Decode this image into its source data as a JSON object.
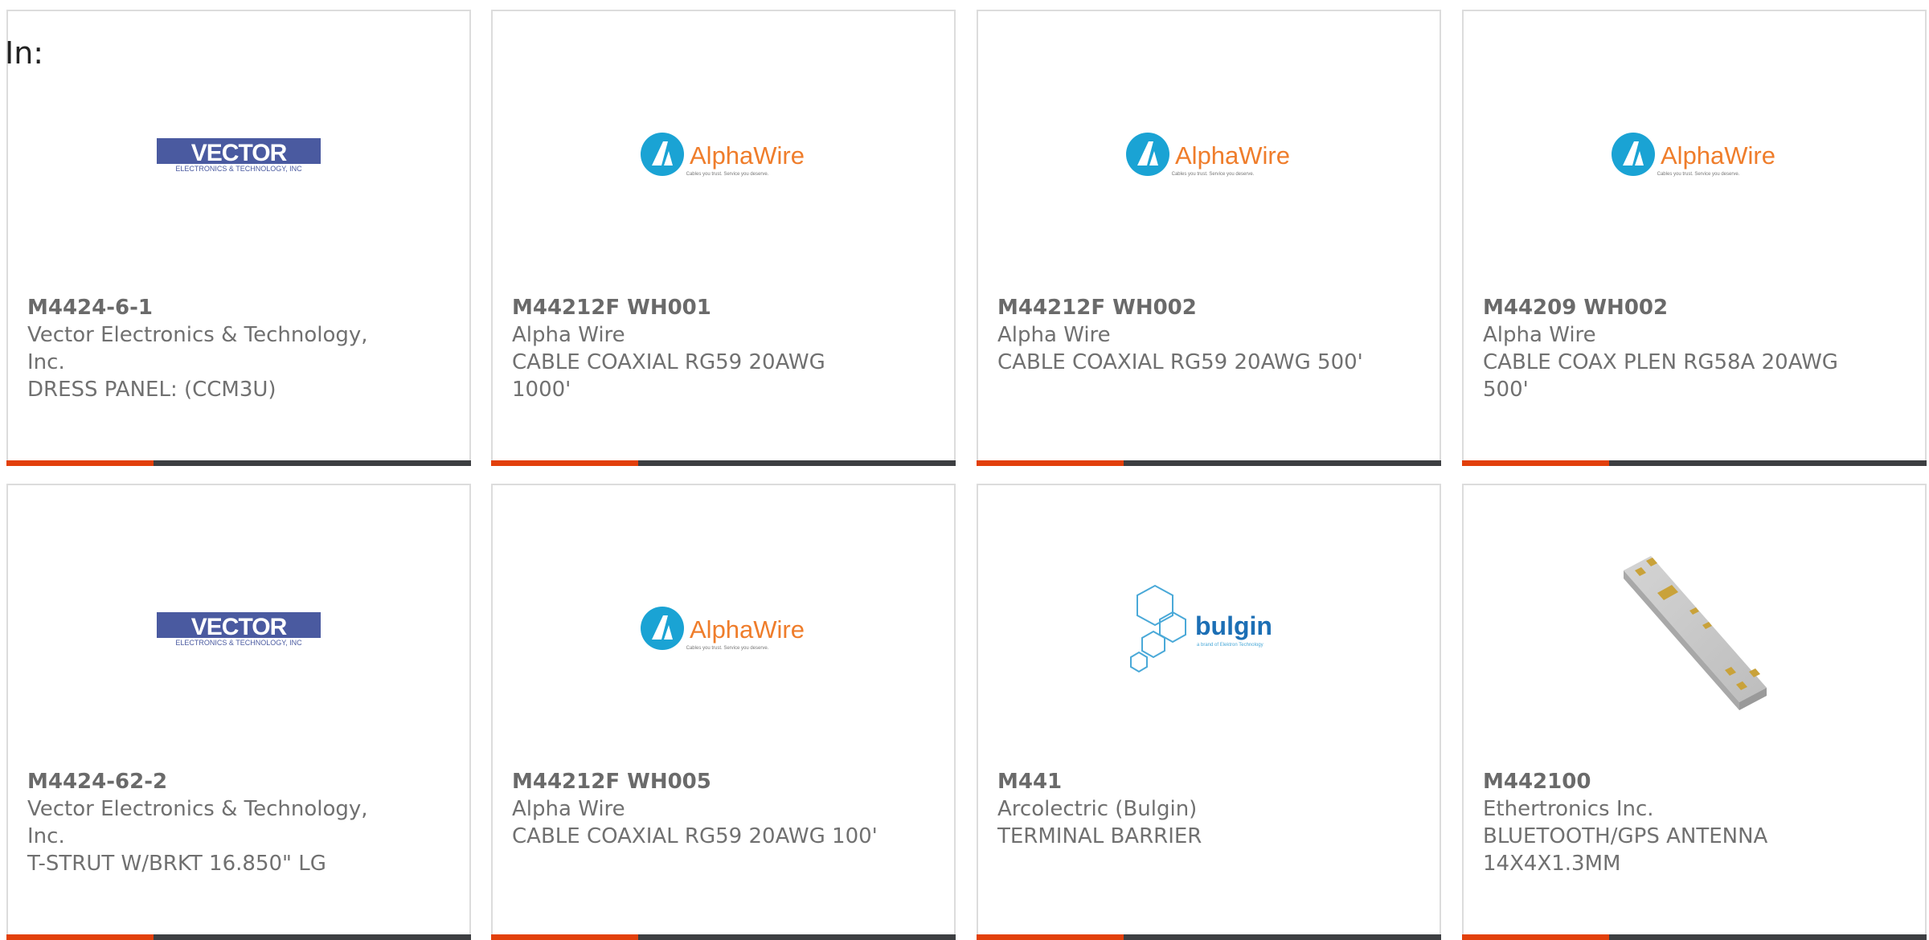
{
  "header": {
    "label": "In:"
  },
  "colors": {
    "accent": "#e2400b",
    "bar": "#3d3f42",
    "border": "#dcdcdc",
    "text": "#707070"
  },
  "products": [
    {
      "part": "M4424-6-1",
      "manufacturer": "Vector Electronics & Technology, Inc.",
      "description": "DRESS PANEL: (CCM3U)",
      "logo": "vector-logo"
    },
    {
      "part": "M44212F WH001",
      "manufacturer": "Alpha Wire",
      "description": "CABLE COAXIAL RG59 20AWG 1000'",
      "logo": "alphawire-logo"
    },
    {
      "part": "M44212F WH002",
      "manufacturer": "Alpha Wire",
      "description": "CABLE COAXIAL RG59 20AWG 500'",
      "logo": "alphawire-logo"
    },
    {
      "part": "M44209 WH002",
      "manufacturer": "Alpha Wire",
      "description": "CABLE COAX PLEN RG58A 20AWG 500'",
      "logo": "alphawire-logo"
    },
    {
      "part": "M4424-62-2",
      "manufacturer": "Vector Electronics & Technology, Inc.",
      "description": "T-STRUT W/BRKT 16.850\" LG",
      "logo": "vector-logo"
    },
    {
      "part": "M44212F WH005",
      "manufacturer": "Alpha Wire",
      "description": "CABLE COAXIAL RG59 20AWG 100'",
      "logo": "alphawire-logo"
    },
    {
      "part": "M441",
      "manufacturer": "Arcolectric (Bulgin)",
      "description": "TERMINAL BARRIER",
      "logo": "bulgin-logo"
    },
    {
      "part": "M442100",
      "manufacturer": "Ethertronics Inc.",
      "description": "BLUETOOTH/GPS ANTENNA 14X4X1.3MM",
      "logo": "antenna-photo"
    }
  ],
  "logos": {
    "vector": {
      "main": "VECTOR",
      "sub": "ELECTRONICS & TECHNOLOGY, INC"
    },
    "alphawire": {
      "main": "AlphaWire",
      "tagline": "Cables you trust. Service you deserve."
    },
    "bulgin": {
      "main": "bulgin",
      "tagline": "a brand of Elektron Technology"
    }
  }
}
